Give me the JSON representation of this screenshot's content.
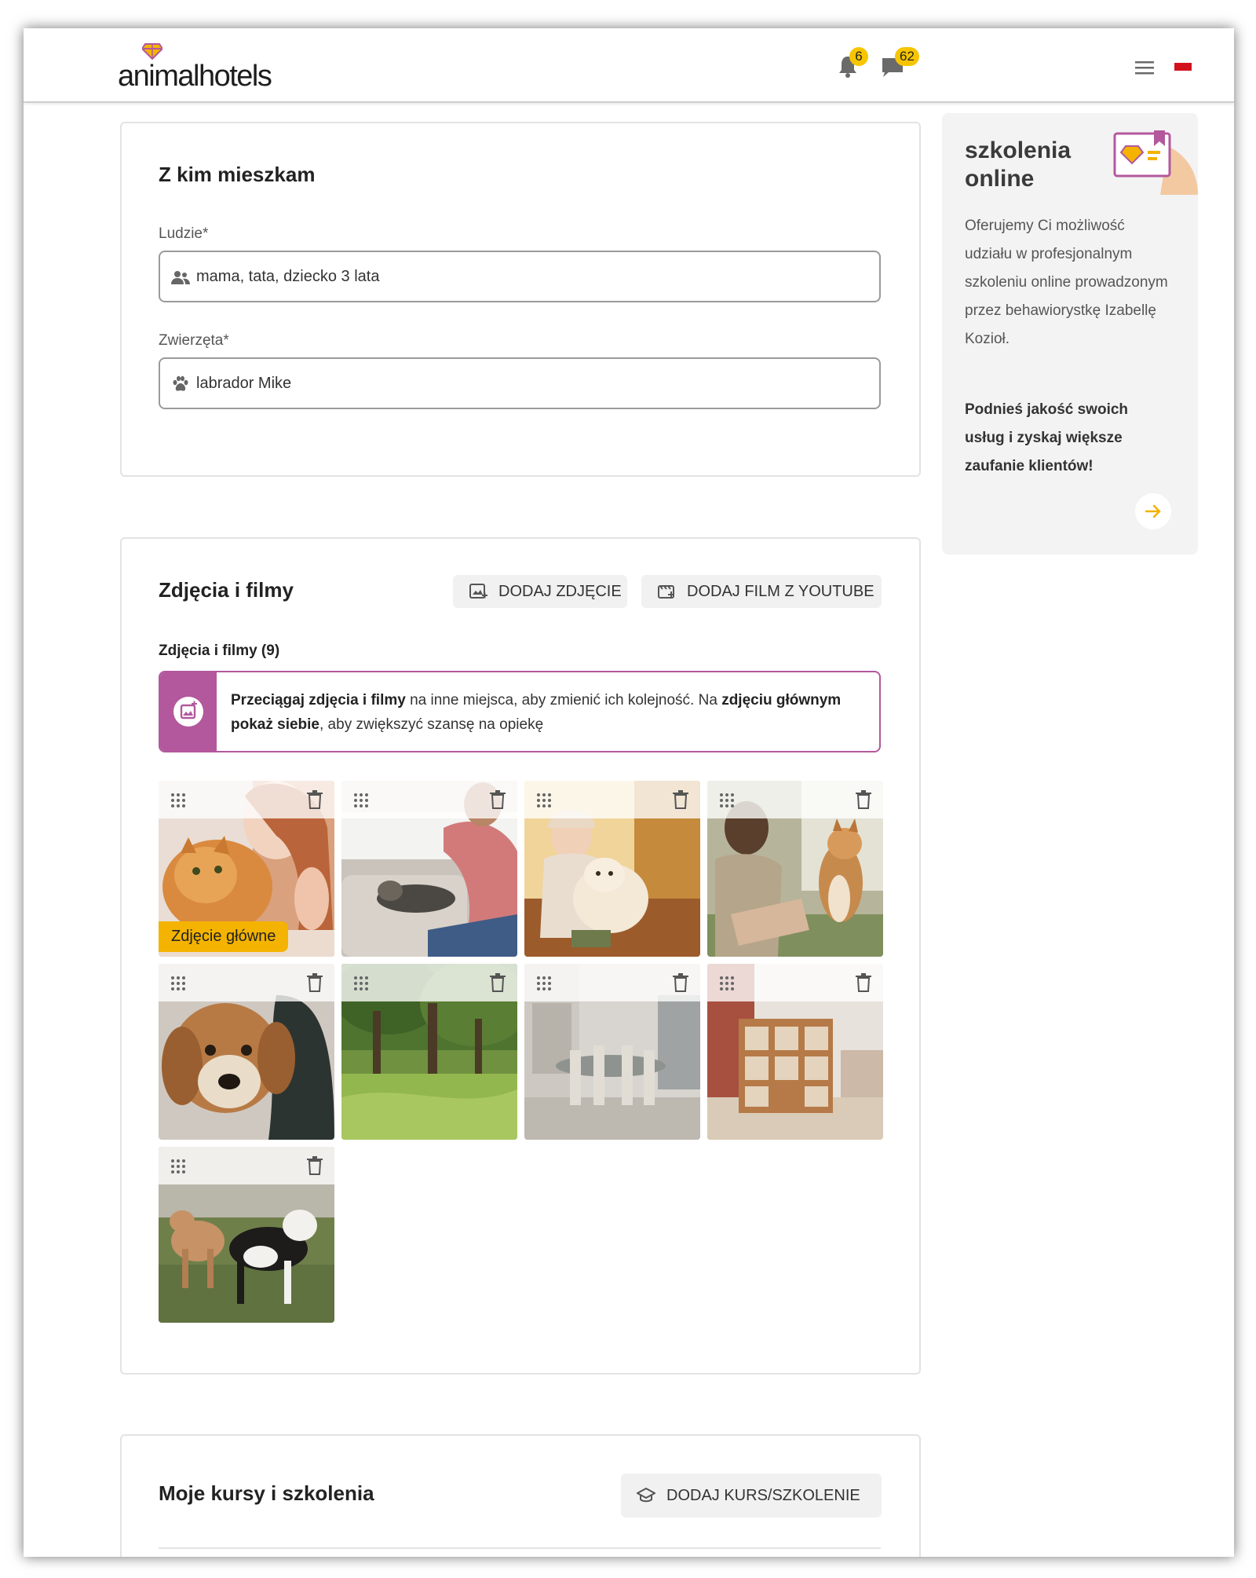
{
  "header": {
    "logo_text": "animalhotels",
    "notifications_count": "6",
    "messages_count": "62"
  },
  "living": {
    "title": "Z kim mieszkam",
    "people_label": "Ludzie*",
    "people_value": "mama, tata, dziecko 3 lata",
    "animals_label": "Zwierzęta*",
    "animals_value": "labrador Mike"
  },
  "media": {
    "title": "Zdjęcia i filmy",
    "add_photo": "DODAJ ZDJĘCIE",
    "add_video": "DODAJ FILM Z YOUTUBE",
    "subtitle": "Zdjęcia i filmy (9)",
    "info_b1": "Przeciągaj zdjęcia i filmy",
    "info_t1": " na inne miejsca, aby zmienić ich kolejność. Na ",
    "info_b2": "zdjęciu głównym pokaż siebie",
    "info_t2": ", aby zwiększyć szansę na opiekę",
    "main_photo_badge": "Zdjęcie główne",
    "photos": [
      {
        "subject": "woman-with-cat"
      },
      {
        "subject": "man-with-cat-on-sofa"
      },
      {
        "subject": "woman-with-golden-retriever"
      },
      {
        "subject": "woman-with-shiba"
      },
      {
        "subject": "dog-closeup"
      },
      {
        "subject": "park-trees"
      },
      {
        "subject": "dining-room"
      },
      {
        "subject": "living-room-shelves"
      },
      {
        "subject": "dogs-on-grass"
      }
    ]
  },
  "courses": {
    "title": "Moje kursy i szkolenia",
    "add_course": "DODAJ KURS/SZKOLENIE"
  },
  "promo": {
    "title": "szkolenia online",
    "text": "Oferujemy Ci możliwość udziału w profesjonalnym szkoleniu online prowadzonym przez behawiorystkę Izabellę Kozioł.",
    "strong": "Podnieś jakość swoich usług i zyskaj większe zaufanie klientów!"
  },
  "colors": {
    "accent_yellow": "#f3b300",
    "accent_purple": "#b3589d",
    "flag_red": "#d2111d"
  }
}
